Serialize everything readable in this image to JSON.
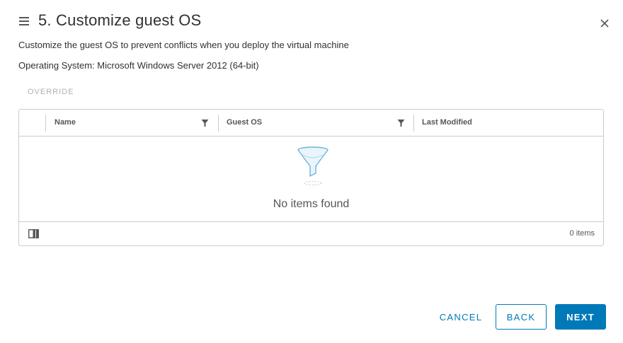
{
  "header": {
    "title": "5. Customize guest OS",
    "menu_icon": "hamburger-menu-icon",
    "close_icon": "close-icon"
  },
  "description": "Customize the guest OS to prevent conflicts when you deploy the virtual machine",
  "operating_system": "Operating System: Microsoft Windows Server 2012 (64-bit)",
  "toolbar": {
    "override_label": "OVERRIDE",
    "override_enabled": false
  },
  "grid": {
    "columns": [
      {
        "label": "Name",
        "filterable": true
      },
      {
        "label": "Guest OS",
        "filterable": true
      },
      {
        "label": "Last Modified",
        "filterable": false
      }
    ],
    "rows": [],
    "empty_text": "No items found",
    "empty_icon": "funnel-empty-icon",
    "footer": {
      "column_toggle_icon": "column-toggle-icon",
      "item_count": "0 items"
    }
  },
  "buttons": {
    "cancel": "CANCEL",
    "back": "BACK",
    "next": "NEXT"
  },
  "colors": {
    "accent": "#0079b8",
    "text": "#313131",
    "muted": "#b0b0b0",
    "border": "#cccccc",
    "empty_icon": "#6db4dc"
  }
}
